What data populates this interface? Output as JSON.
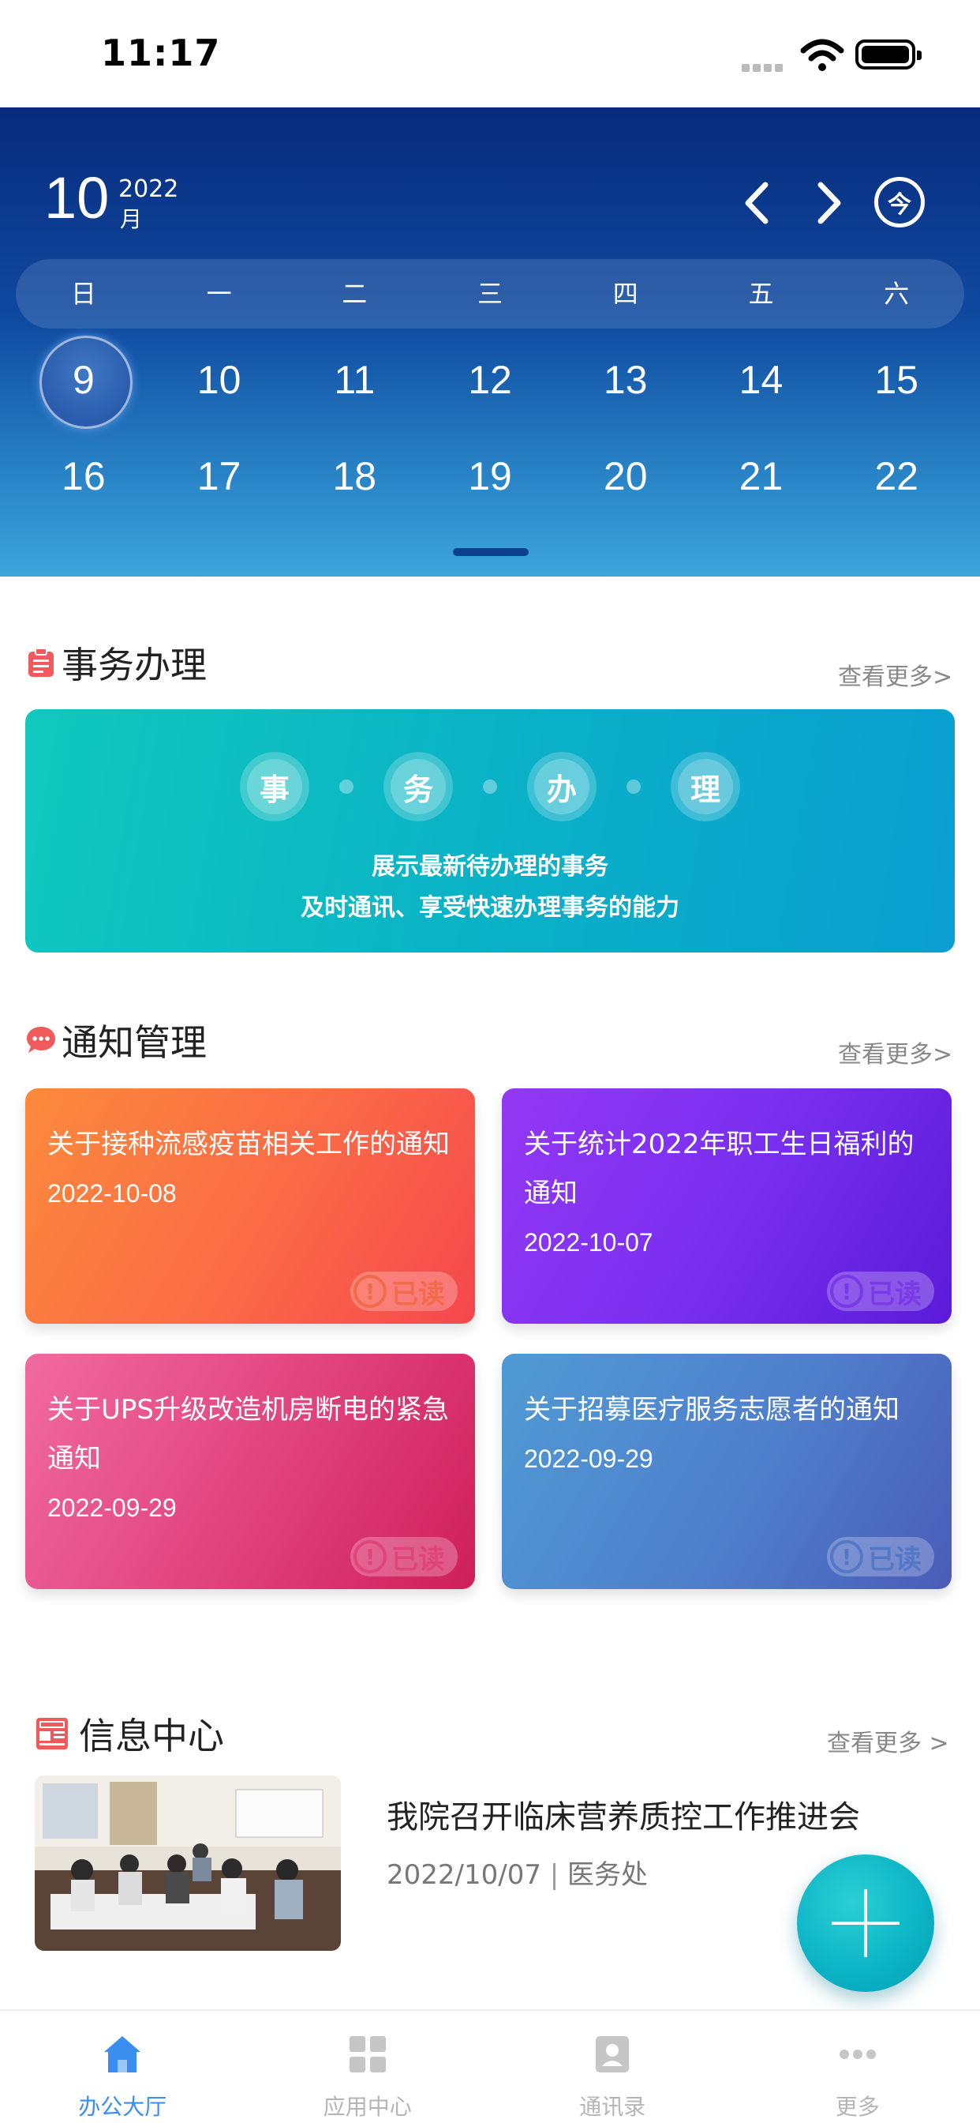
{
  "status_bar": {
    "time": "11:17"
  },
  "calendar": {
    "month": "10",
    "year": "2022",
    "month_unit": "月",
    "today_label": "今",
    "weekdays": [
      "日",
      "一",
      "二",
      "三",
      "四",
      "五",
      "六"
    ],
    "weeks": [
      [
        "9",
        "10",
        "11",
        "12",
        "13",
        "14",
        "15"
      ],
      [
        "16",
        "17",
        "18",
        "19",
        "20",
        "21",
        "22"
      ]
    ],
    "selected_day": "9"
  },
  "tasks": {
    "title": "事务办理",
    "more": "查看更多>",
    "chars": [
      "事",
      "务",
      "办",
      "理"
    ],
    "line1": "展示最新待办理的事务",
    "line2": "及时通讯、享受快速办理事务的能力"
  },
  "notices": {
    "title": "通知管理",
    "more": "查看更多>",
    "items": [
      {
        "title": "关于接种流感疫苗相关工作的通知",
        "date": "2022-10-08",
        "status": "已读",
        "color": "#f7763f"
      },
      {
        "title": "关于统计2022年职工生日福利的通知",
        "date": "2022-10-07",
        "status": "已读",
        "color": "#7a2ff0"
      },
      {
        "title": "关于UPS升级改造机房断电的紧急通知",
        "date": "2022-09-29",
        "status": "已读",
        "color": "#e2457e"
      },
      {
        "title": "关于招募医疗服务志愿者的通知",
        "date": "2022-09-29",
        "status": "已读",
        "color": "#4f7fcc"
      }
    ]
  },
  "info": {
    "title": "信息中心",
    "more": "查看更多 >",
    "items": [
      {
        "title": "我院召开临床营养质控工作推进会",
        "date": "2022/10/07",
        "department": "医务处"
      }
    ]
  },
  "tabbar": {
    "items": [
      {
        "label": "办公大厅",
        "icon": "home-icon"
      },
      {
        "label": "应用中心",
        "icon": "grid-icon"
      },
      {
        "label": "通讯录",
        "icon": "contacts-icon"
      },
      {
        "label": "更多",
        "icon": "more-dots-icon"
      }
    ],
    "active_color": "#3a8ef0"
  }
}
